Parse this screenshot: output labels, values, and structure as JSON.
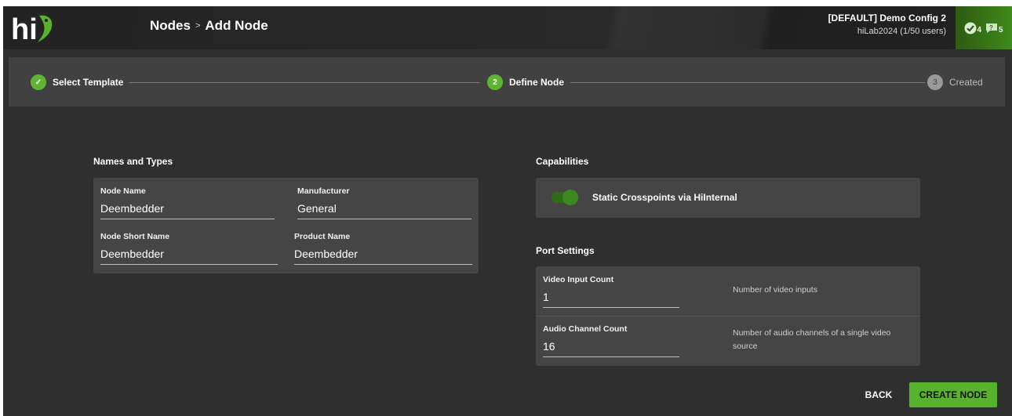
{
  "header": {
    "breadcrumb": [
      "Nodes",
      "Add Node"
    ],
    "breadcrumb_separator": ">",
    "config_name": "[DEFAULT] Demo Config 2",
    "user_info": "hiLab2024 (1/50 users)",
    "status": {
      "ok_count": "4",
      "messages_count": "5"
    }
  },
  "stepper": {
    "steps": [
      {
        "label": "Select Template",
        "marker": "✓",
        "state": "done"
      },
      {
        "label": "Define Node",
        "marker": "2",
        "state": "active"
      },
      {
        "label": "Created",
        "marker": "3",
        "state": "pending"
      }
    ]
  },
  "names_section": {
    "title": "Names and Types",
    "fields": {
      "node_name": {
        "label": "Node Name",
        "value": "Deembedder"
      },
      "manufacturer": {
        "label": "Manufacturer",
        "value": "General"
      },
      "node_short_name": {
        "label": "Node Short Name",
        "value": "Deembedder"
      },
      "product_name": {
        "label": "Product Name",
        "value": "Deembedder"
      }
    }
  },
  "capabilities": {
    "title": "Capabilities",
    "toggle_label": "Static Crosspoints via HiInternal",
    "toggle_on": true
  },
  "port_settings": {
    "title": "Port Settings",
    "video_input": {
      "label": "Video Input Count",
      "value": "1",
      "description": "Number of video inputs"
    },
    "audio_channel": {
      "label": "Audio Channel Count",
      "value": "16",
      "description": "Number of audio channels of a single video source"
    }
  },
  "actions": {
    "back": "BACK",
    "create": "CREATE NODE"
  },
  "colors": {
    "accent": "#58b32c",
    "background": "#2f2f2f",
    "card": "#454545"
  }
}
